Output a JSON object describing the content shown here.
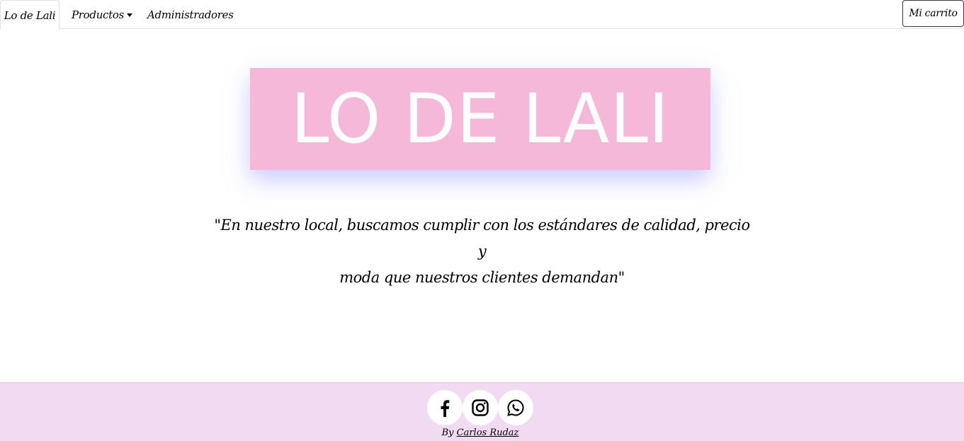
{
  "navbar": {
    "brand_label": "Lo de Lali",
    "products_label": "Productos",
    "admins_label": "Administradores",
    "cart_label": "Mi carrito"
  },
  "hero": {
    "title": "LO DE LALI"
  },
  "quote": {
    "line1": "\"En nuestro local, buscamos cumplir con los estándares de calidad, precio y",
    "line2": "moda que nuestros clientes demandan\""
  },
  "footer": {
    "social_icons": [
      "facebook-icon",
      "instagram-icon",
      "whatsapp-icon"
    ],
    "credit_prefix": "By",
    "credit_author": "Carlos Rudaz"
  },
  "colors": {
    "hero_bg": "#f5b8d9",
    "footer_bg": "#f3daf3",
    "hero_text": "#ffffff"
  }
}
